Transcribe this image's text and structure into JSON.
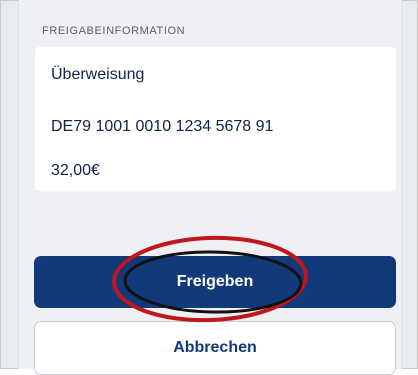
{
  "section": {
    "label": "FREIGABEINFORMATION"
  },
  "info": {
    "type": "Überweisung",
    "iban": "DE79 1001 0010 1234 5678 91",
    "amount": "32,00€"
  },
  "actions": {
    "approve_label": "Freigeben",
    "cancel_label": "Abbrechen"
  },
  "colors": {
    "primary": "#123a7a",
    "annotation_red": "#c0161c",
    "annotation_black": "#111111"
  }
}
